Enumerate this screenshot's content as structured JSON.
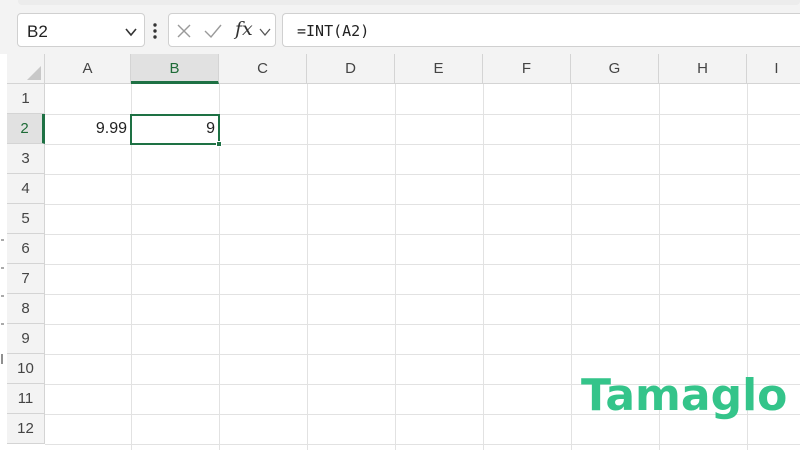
{
  "name_box": {
    "value": "B2",
    "icon": "chevron-down-icon"
  },
  "formula_bar": {
    "cancel_icon": "x-icon",
    "enter_icon": "check-icon",
    "function_label": "fx",
    "formula": "=INT(A2)"
  },
  "columns": [
    "A",
    "B",
    "C",
    "D",
    "E",
    "F",
    "G",
    "H",
    "I"
  ],
  "rows": [
    "1",
    "2",
    "3",
    "4",
    "5",
    "6",
    "7",
    "8",
    "9",
    "10",
    "11",
    "12"
  ],
  "active_cell": "B2",
  "cells": {
    "A2": "9.99",
    "B2": "9"
  },
  "watermark": "Tamaglo",
  "colors": {
    "accent": "#1e7144",
    "watermark": "#34c48a"
  }
}
